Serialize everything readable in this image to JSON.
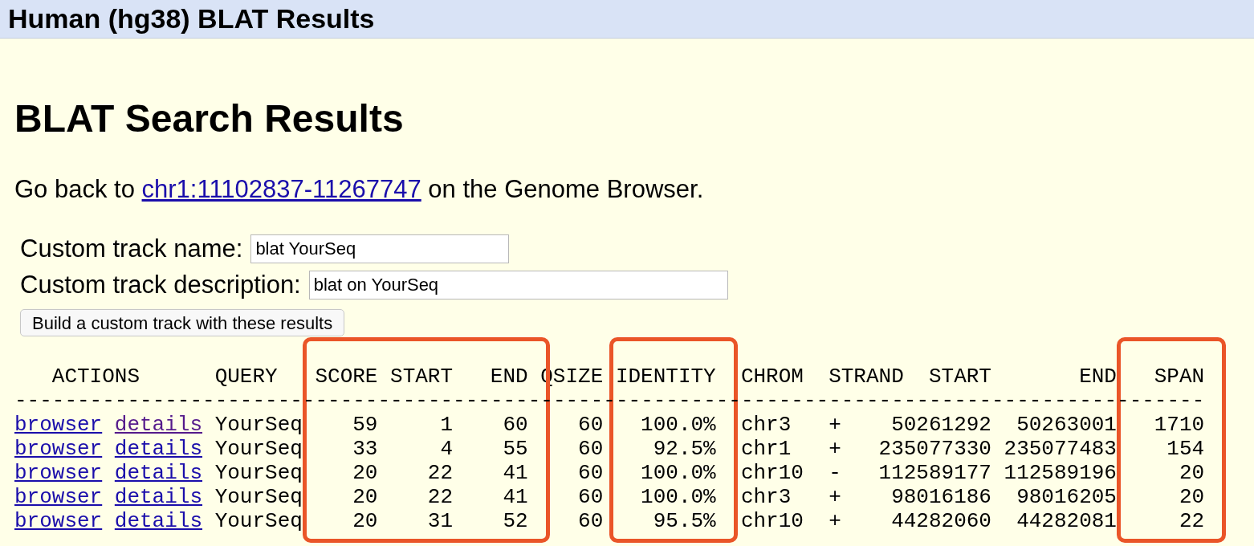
{
  "title_bar": "Human (hg38) BLAT Results",
  "heading": "BLAT Search Results",
  "back_line": {
    "prefix": "Go back to",
    "link": "chr1:11102837-11267747",
    "suffix": "on the Genome Browser."
  },
  "form": {
    "fields": [
      {
        "label": "Custom track name:",
        "value": "blat YourSeq"
      },
      {
        "label": "Custom track description:",
        "value": "blat on YourSeq"
      }
    ],
    "button": "Build a custom track with these results"
  },
  "table": {
    "actions_header": "ACTIONS",
    "columns": [
      {
        "label": "QUERY",
        "highlighted": false
      },
      {
        "label": "SCORE",
        "highlighted": true
      },
      {
        "label": "START",
        "highlighted": true
      },
      {
        "label": "END",
        "highlighted": true
      },
      {
        "label": "QSIZE",
        "highlighted": false
      },
      {
        "label": "IDENTITY",
        "highlighted": true
      },
      {
        "label": "CHROM",
        "highlighted": false
      },
      {
        "label": "STRAND",
        "highlighted": false
      },
      {
        "label": "START",
        "highlighted": false
      },
      {
        "label": "END",
        "highlighted": false
      },
      {
        "label": "SPAN",
        "highlighted": true
      }
    ],
    "rule": "-----------------------------------------------------------------------------------------------",
    "rows": [
      {
        "actions": [
          {
            "label": "browser",
            "visited": false
          },
          {
            "label": "details",
            "visited": true
          }
        ],
        "cells": [
          "YourSeq",
          "59",
          "1",
          "60",
          "60",
          "100.0%",
          "chr3",
          "+",
          "50261292",
          "50263001",
          "1710"
        ]
      },
      {
        "actions": [
          {
            "label": "browser",
            "visited": false
          },
          {
            "label": "details",
            "visited": false
          }
        ],
        "cells": [
          "YourSeq",
          "33",
          "4",
          "55",
          "60",
          "92.5%",
          "chr1",
          "+",
          "235077330",
          "235077483",
          "154"
        ]
      },
      {
        "actions": [
          {
            "label": "browser",
            "visited": false
          },
          {
            "label": "details",
            "visited": false
          }
        ],
        "cells": [
          "YourSeq",
          "20",
          "22",
          "41",
          "60",
          "100.0%",
          "chr10",
          "-",
          "112589177",
          "112589196",
          "20"
        ]
      },
      {
        "actions": [
          {
            "label": "browser",
            "visited": false
          },
          {
            "label": "details",
            "visited": false
          }
        ],
        "cells": [
          "YourSeq",
          "20",
          "22",
          "41",
          "60",
          "100.0%",
          "chr3",
          "+",
          "98016186",
          "98016205",
          "20"
        ]
      },
      {
        "actions": [
          {
            "label": "browser",
            "visited": false
          },
          {
            "label": "details",
            "visited": false
          }
        ],
        "cells": [
          "YourSeq",
          "20",
          "31",
          "52",
          "60",
          "95.5%",
          "chr10",
          "+",
          "44282060",
          "44282081",
          "22"
        ]
      }
    ]
  }
}
